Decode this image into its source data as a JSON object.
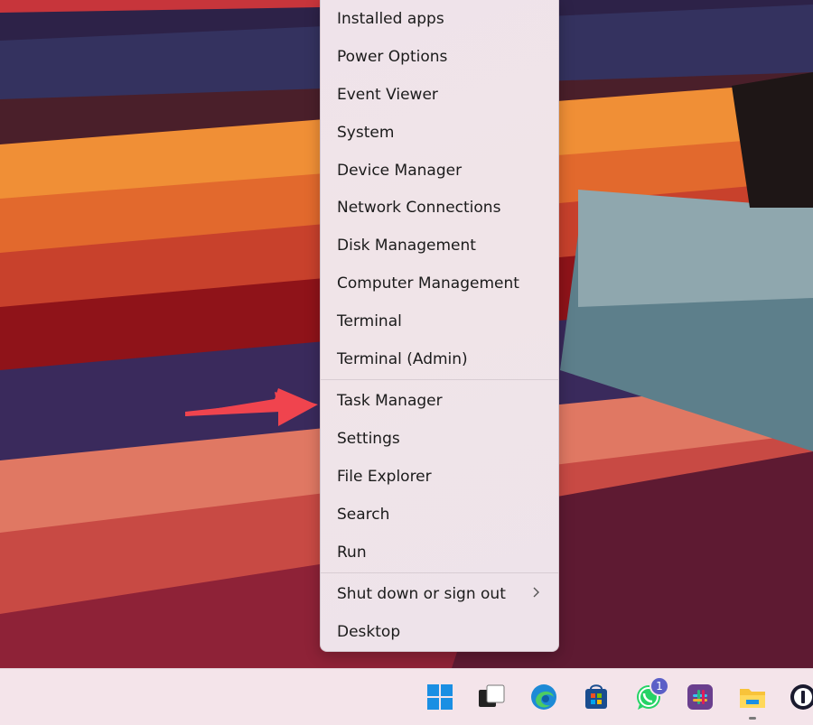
{
  "menu": {
    "items": [
      {
        "label": "Installed apps"
      },
      {
        "label": "Power Options"
      },
      {
        "label": "Event Viewer"
      },
      {
        "label": "System"
      },
      {
        "label": "Device Manager"
      },
      {
        "label": "Network Connections"
      },
      {
        "label": "Disk Management"
      },
      {
        "label": "Computer Management"
      },
      {
        "label": "Terminal"
      },
      {
        "label": "Terminal (Admin)"
      },
      {
        "label": "Task Manager"
      },
      {
        "label": "Settings"
      },
      {
        "label": "File Explorer"
      },
      {
        "label": "Search"
      },
      {
        "label": "Run"
      },
      {
        "label": "Shut down or sign out"
      },
      {
        "label": "Desktop"
      }
    ]
  },
  "taskbar": {
    "icons": [
      "windows-start-icon",
      "task-view-icon",
      "edge-browser-icon",
      "microsoft-store-icon",
      "whatsapp-icon",
      "slack-icon",
      "file-explorer-icon",
      "1password-icon"
    ],
    "whatsapp_badge": "1"
  },
  "colors": {
    "arrow": "#f0444e",
    "menu_bg": "#efe3ea",
    "taskbar_bg": "#f4e4ea"
  }
}
